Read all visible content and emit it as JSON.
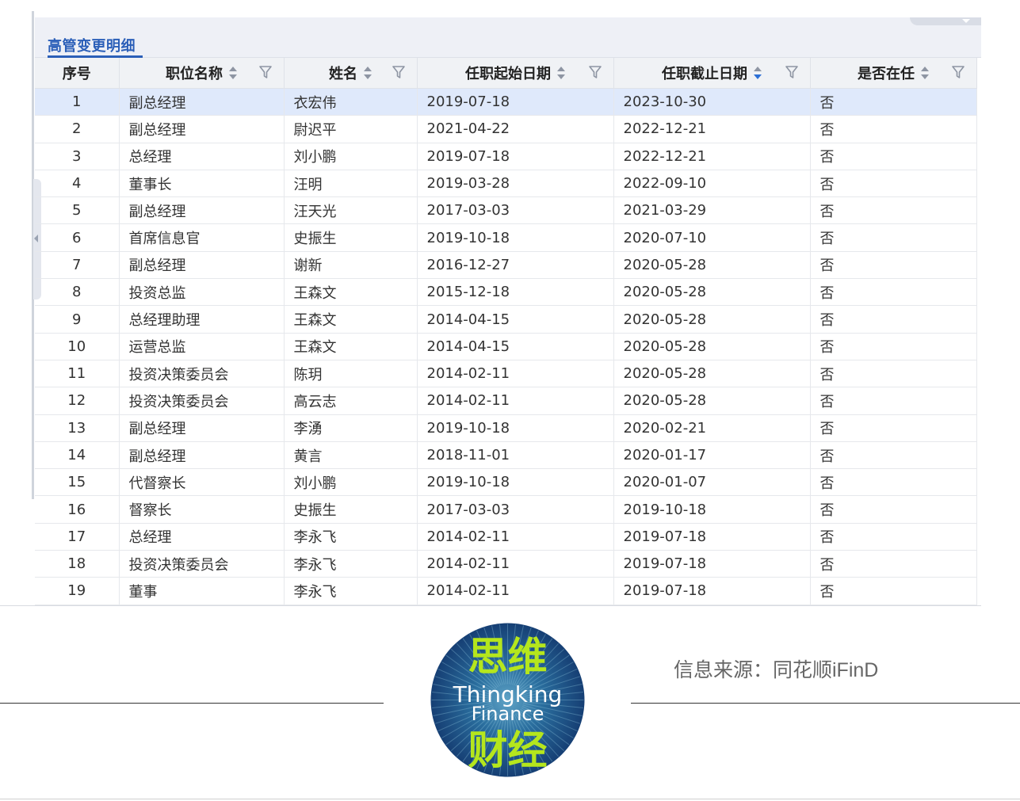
{
  "tab": {
    "label": "高管变更明细"
  },
  "columns": [
    {
      "key": "no",
      "label": "序号"
    },
    {
      "key": "position",
      "label": "职位名称"
    },
    {
      "key": "name",
      "label": "姓名"
    },
    {
      "key": "start",
      "label": "任职起始日期"
    },
    {
      "key": "end",
      "label": "任职截止日期"
    },
    {
      "key": "current",
      "label": "是否在任"
    }
  ],
  "rows": [
    [
      "1",
      "副总经理",
      "衣宏伟",
      "2019-07-18",
      "2023-10-30",
      "否"
    ],
    [
      "2",
      "副总经理",
      "尉迟平",
      "2021-04-22",
      "2022-12-21",
      "否"
    ],
    [
      "3",
      "总经理",
      "刘小鹏",
      "2019-07-18",
      "2022-12-21",
      "否"
    ],
    [
      "4",
      "董事长",
      "汪明",
      "2019-03-28",
      "2022-09-10",
      "否"
    ],
    [
      "5",
      "副总经理",
      "汪天光",
      "2017-03-03",
      "2021-03-29",
      "否"
    ],
    [
      "6",
      "首席信息官",
      "史振生",
      "2019-10-18",
      "2020-07-10",
      "否"
    ],
    [
      "7",
      "副总经理",
      "谢新",
      "2016-12-27",
      "2020-05-28",
      "否"
    ],
    [
      "8",
      "投资总监",
      "王森文",
      "2015-12-18",
      "2020-05-28",
      "否"
    ],
    [
      "9",
      "总经理助理",
      "王森文",
      "2014-04-15",
      "2020-05-28",
      "否"
    ],
    [
      "10",
      "运营总监",
      "王森文",
      "2014-04-15",
      "2020-05-28",
      "否"
    ],
    [
      "11",
      "投资决策委员会",
      "陈玥",
      "2014-02-11",
      "2020-05-28",
      "否"
    ],
    [
      "12",
      "投资决策委员会",
      "高云志",
      "2014-02-11",
      "2020-05-28",
      "否"
    ],
    [
      "13",
      "副总经理",
      "李湧",
      "2019-10-18",
      "2020-02-21",
      "否"
    ],
    [
      "14",
      "副总经理",
      "黄言",
      "2018-11-01",
      "2020-01-17",
      "否"
    ],
    [
      "15",
      "代督察长",
      "刘小鹏",
      "2019-10-18",
      "2020-01-07",
      "否"
    ],
    [
      "16",
      "督察长",
      "史振生",
      "2017-03-03",
      "2019-10-18",
      "否"
    ],
    [
      "17",
      "总经理",
      "李永飞",
      "2014-02-11",
      "2019-07-18",
      "否"
    ],
    [
      "18",
      "投资决策委员会",
      "李永飞",
      "2014-02-11",
      "2019-07-18",
      "否"
    ],
    [
      "19",
      "董事",
      "李永飞",
      "2014-02-11",
      "2019-07-18",
      "否"
    ]
  ],
  "selected_row": 0,
  "sorted_column": "end",
  "logo": {
    "top": "思维",
    "line1": "Thingking",
    "line2": "Finance",
    "bottom": "财经"
  },
  "source": "信息来源：同花顺iFinD",
  "colors": {
    "accent": "#2b5fb8",
    "selected": "#dfe9fb",
    "logo_bg": "#1f5c8f",
    "logo_text": "#b5e61d"
  }
}
